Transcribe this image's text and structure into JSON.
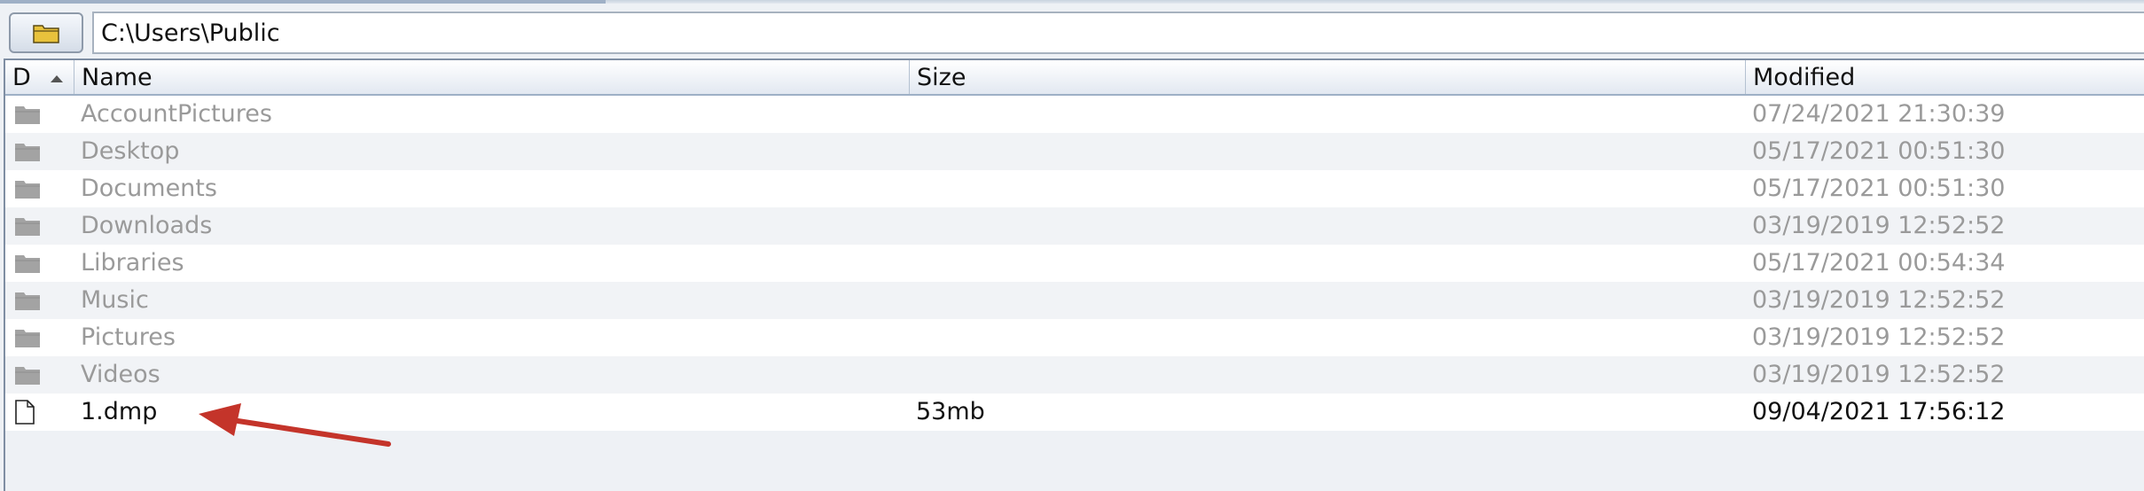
{
  "toolbar": {
    "browse_icon": "folder-icon",
    "path_value": "C:\\Users\\Public"
  },
  "table": {
    "columns": {
      "d": "D",
      "name": "Name",
      "size": "Size",
      "modified": "Modified"
    },
    "sort_column": "D",
    "sort_direction": "ascending",
    "rows": [
      {
        "type": "folder",
        "name": "AccountPictures",
        "size": "",
        "modified": "07/24/2021 21:30:39"
      },
      {
        "type": "folder",
        "name": "Desktop",
        "size": "",
        "modified": "05/17/2021 00:51:30"
      },
      {
        "type": "folder",
        "name": "Documents",
        "size": "",
        "modified": "05/17/2021 00:51:30"
      },
      {
        "type": "folder",
        "name": "Downloads",
        "size": "",
        "modified": "03/19/2019 12:52:52"
      },
      {
        "type": "folder",
        "name": "Libraries",
        "size": "",
        "modified": "05/17/2021 00:54:34"
      },
      {
        "type": "folder",
        "name": "Music",
        "size": "",
        "modified": "03/19/2019 12:52:52"
      },
      {
        "type": "folder",
        "name": "Pictures",
        "size": "",
        "modified": "03/19/2019 12:52:52"
      },
      {
        "type": "folder",
        "name": "Videos",
        "size": "",
        "modified": "03/19/2019 12:52:52"
      },
      {
        "type": "file",
        "name": "1.dmp",
        "size": "53mb",
        "modified": "09/04/2021 17:56:12"
      }
    ]
  },
  "annotation": {
    "type": "arrow",
    "color": "#c4342a",
    "points_to": "1.dmp"
  },
  "colors": {
    "folder_text": "#9a9a9a",
    "file_text": "#111111",
    "folder_icon": "#a3a3a3",
    "header_border": "#9eb0c6"
  }
}
